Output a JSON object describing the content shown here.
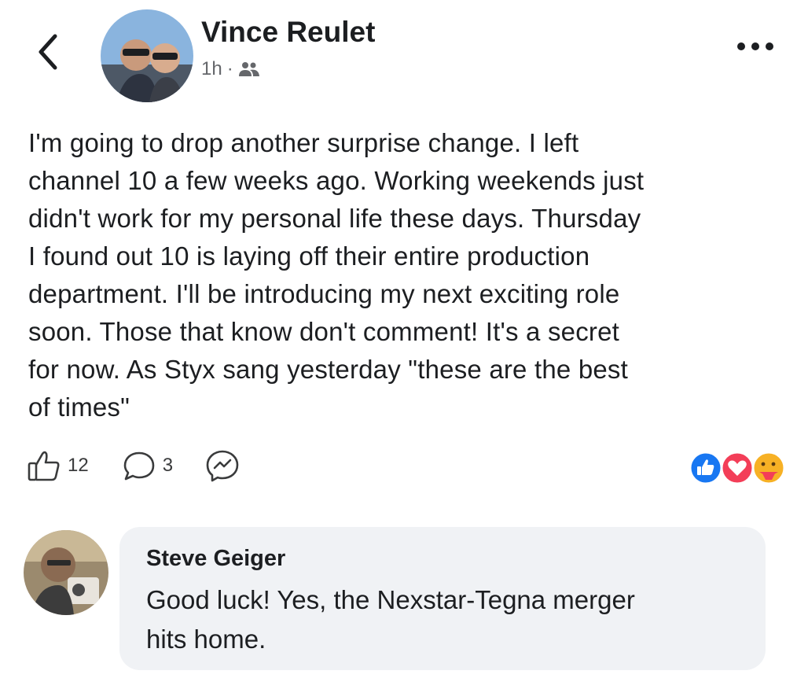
{
  "post": {
    "author": "Vince Reulet",
    "time": "1h",
    "separator": "·",
    "body_lines": [
      "I'm going to drop another surprise change.  I left",
      "channel 10 a few weeks ago. Working weekends just",
      "didn't work for my personal life these days.  Thursday",
      "I found out 10 is laying off their entire production",
      "department. I'll be introducing my next exciting role",
      "soon. Those that know don't comment! It's a secret",
      "for now.  As Styx sang yesterday \"these are the best",
      "of times\""
    ],
    "like_count": "12",
    "comment_count": "3"
  },
  "comment": {
    "author": "Steve Geiger",
    "text_lines": [
      "Good luck! Yes, the Nexstar-Tegna merger",
      "hits home."
    ]
  },
  "icons": {
    "back": "chevron-left-icon",
    "more": "more-horizontal-icon",
    "audience": "friends-icon",
    "like": "thumbs-up-icon",
    "comment": "comment-bubble-icon",
    "share": "messenger-icon"
  },
  "colors": {
    "like_reaction": "#1877f2",
    "love_reaction": "#f33e58",
    "care_reaction": "#f7b125",
    "comment_bubble": "#f0f2f5"
  }
}
